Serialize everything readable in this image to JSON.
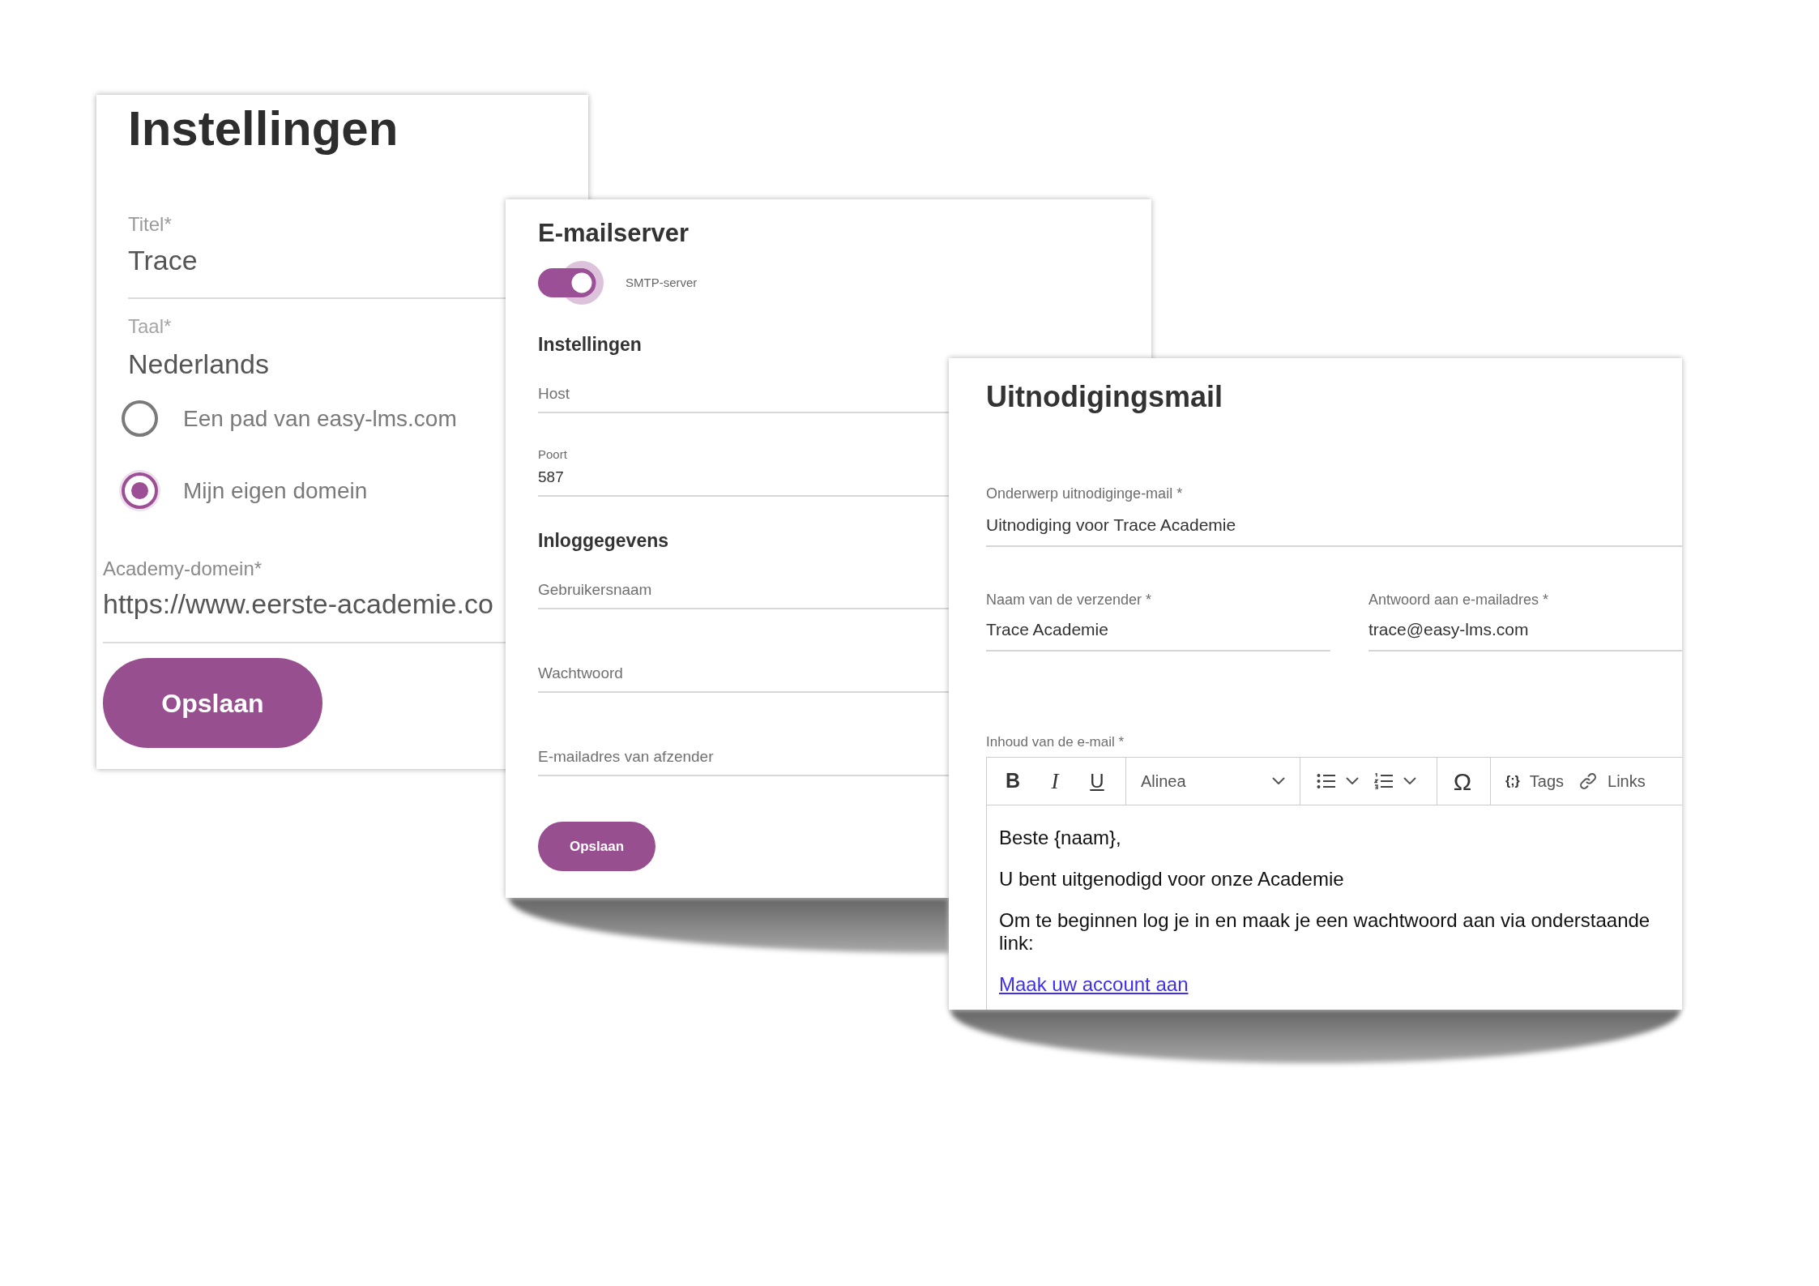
{
  "settings_panel": {
    "title": "Instellingen",
    "fields": [
      {
        "kind": "text",
        "label": "Titel*",
        "value": "Trace"
      },
      {
        "kind": "select",
        "label": "Taal*",
        "value": "Nederlands"
      }
    ],
    "domain_options": [
      {
        "label": "Een pad van easy-lms.com",
        "selected": false
      },
      {
        "label": "Mijn eigen domein",
        "selected": true
      }
    ],
    "domain_field": {
      "label": "Academy-domein*",
      "value": "https://www.eerste-academie.co"
    },
    "save_button": "Opslaan"
  },
  "email_server_panel": {
    "title": "E-mailserver",
    "smtp_toggle": {
      "label": "SMTP-server",
      "on": true
    },
    "sections": [
      {
        "heading": "Instellingen",
        "fields": [
          {
            "placeholder": "Host"
          },
          {
            "label": "Poort",
            "value": "587"
          }
        ]
      },
      {
        "heading": "Inloggegevens",
        "fields": [
          {
            "placeholder": "Gebruikersnaam"
          },
          {
            "placeholder": "Wachtwoord"
          },
          {
            "placeholder": "E-mailadres van afzender"
          }
        ]
      }
    ],
    "save_button": "Opslaan"
  },
  "invitation_panel": {
    "title": "Uitnodigingsmail",
    "subject_field": {
      "label": "Onderwerp uitnodiginge-mail *",
      "value": "Uitnodiging voor Trace Academie"
    },
    "sender_fields": [
      {
        "label": "Naam van de verzender *",
        "value": "Trace Academie"
      },
      {
        "label": "Antwoord aan e-mailadres *",
        "value": "trace@easy-lms.com"
      }
    ],
    "body_label": "Inhoud van de e-mail *",
    "toolbar": [
      {
        "items": [
          {
            "kind": "format",
            "text": "B"
          },
          {
            "kind": "format",
            "text": "I"
          },
          {
            "kind": "format",
            "text": "U"
          }
        ]
      },
      {
        "items": [
          {
            "kind": "dropdown",
            "text": "Alinea"
          }
        ]
      },
      {
        "items": [
          {
            "kind": "bullets"
          },
          {
            "kind": "numbering"
          }
        ]
      },
      {
        "items": [
          {
            "kind": "glyph",
            "text": "Ω"
          }
        ]
      },
      {
        "items": [
          {
            "kind": "symbol",
            "symbol": "{;}",
            "text": "Tags"
          },
          {
            "kind": "link",
            "text": "Links"
          }
        ]
      }
    ],
    "body": [
      {
        "kind": "text",
        "text": "Beste {naam},"
      },
      {
        "kind": "text",
        "text": "U bent uitgenodigd voor onze Academie"
      },
      {
        "kind": "text",
        "text": "Om te beginnen log je in en maak je een wachtwoord aan via onderstaande link:"
      },
      {
        "kind": "link",
        "text": "Maak uw account aan"
      }
    ]
  }
}
